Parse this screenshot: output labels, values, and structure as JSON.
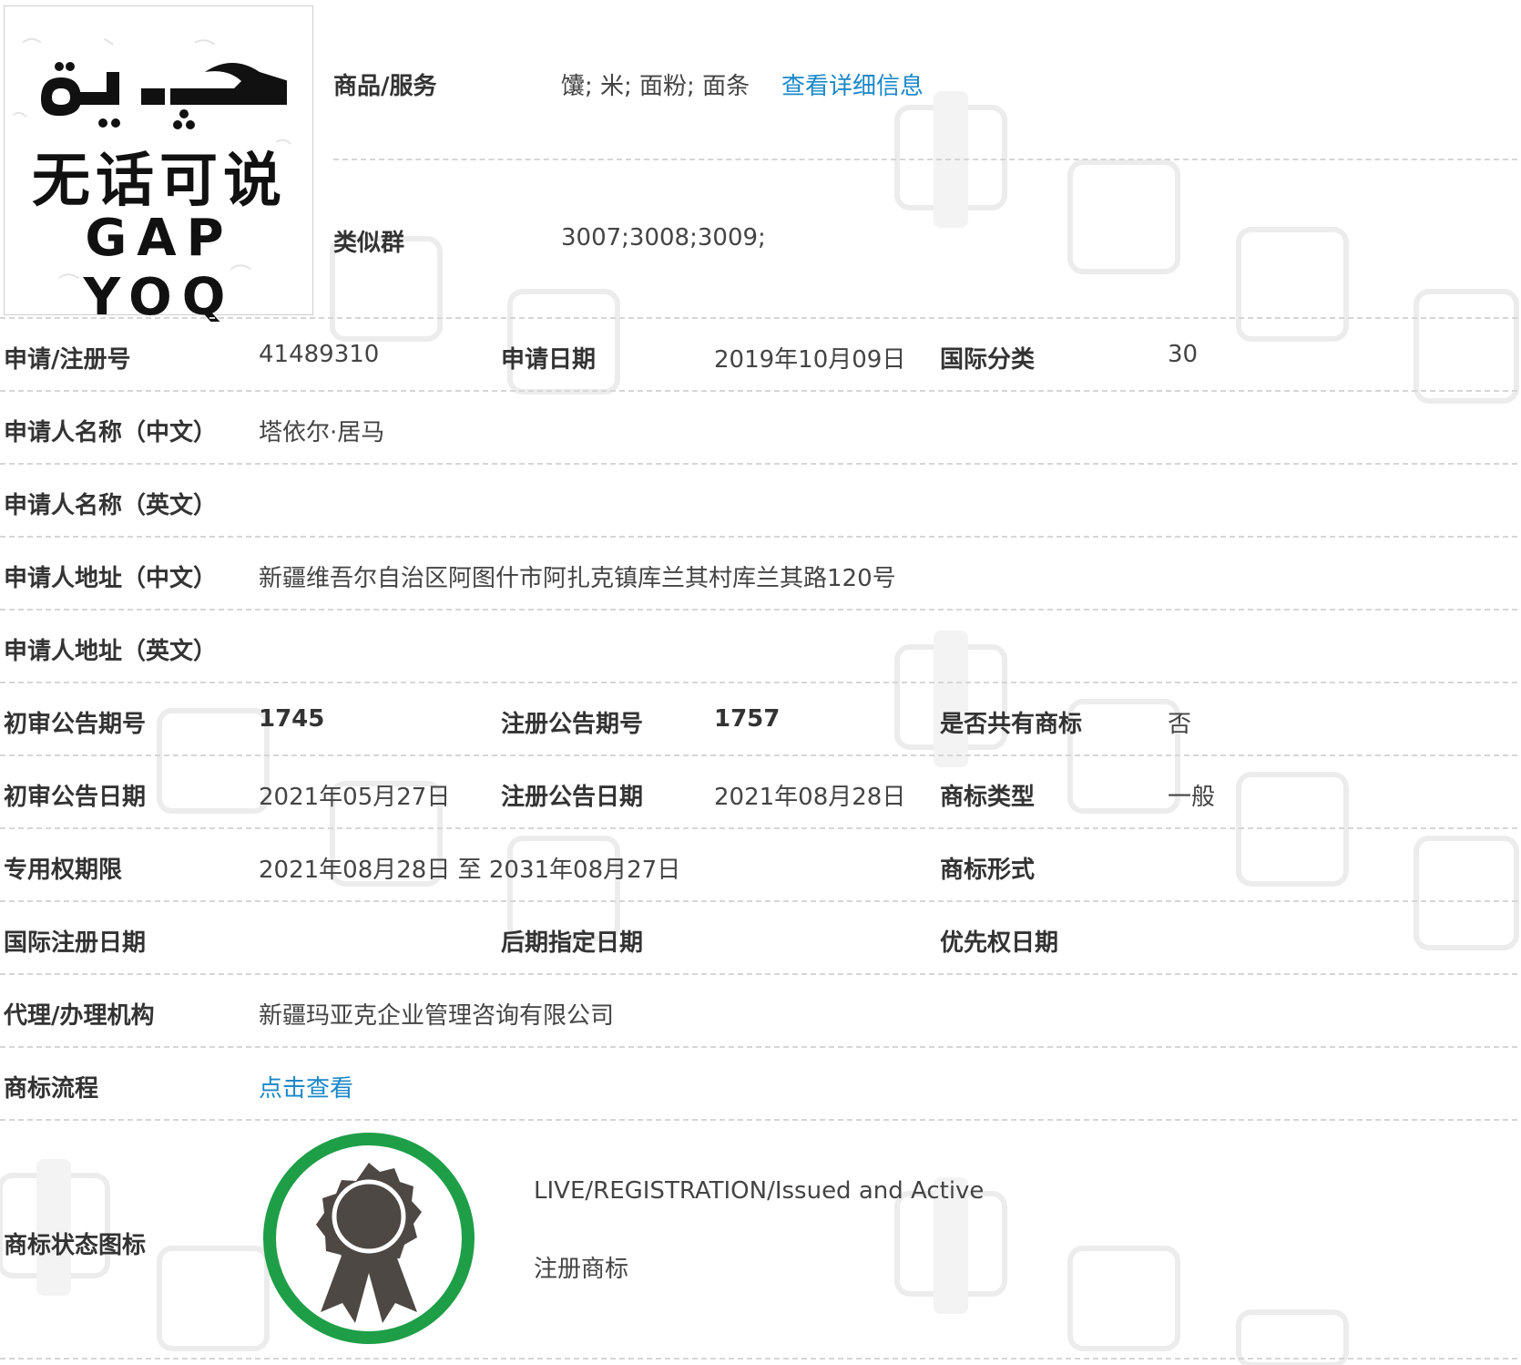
{
  "trademark": {
    "uyghur_text": "گەپ يوق",
    "chinese_text": "无话可说",
    "latin_text": "GAP YOQ"
  },
  "goods": {
    "label": "商品/服务",
    "value": "馕; 米; 面粉; 面条",
    "detail_link": "查看详细信息"
  },
  "similar_group": {
    "label": "类似群",
    "value": "3007;3008;3009;"
  },
  "fields": {
    "reg_no_label": "申请/注册号",
    "reg_no": "41489310",
    "apply_date_label": "申请日期",
    "apply_date": "2019年10月09日",
    "intl_class_label": "国际分类",
    "intl_class": "30",
    "applicant_cn_label": "申请人名称（中文）",
    "applicant_cn": "塔依尔·居马",
    "applicant_en_label": "申请人名称（英文）",
    "applicant_en": "",
    "address_cn_label": "申请人地址（中文）",
    "address_cn": "新疆维吾尔自治区阿图什市阿扎克镇库兰其村库兰其路120号",
    "address_en_label": "申请人地址（英文）",
    "address_en": "",
    "prelim_issue_label": "初审公告期号",
    "prelim_issue": "1745",
    "reg_issue_label": "注册公告期号",
    "reg_issue": "1757",
    "shared_label": "是否共有商标",
    "shared": "否",
    "prelim_date_label": "初审公告日期",
    "prelim_date": "2021年05月27日",
    "reg_date_label": "注册公告日期",
    "reg_date": "2021年08月28日",
    "tm_type_label": "商标类型",
    "tm_type": "一般",
    "term_label": "专用权期限",
    "term": "2021年08月28日 至 2031年08月27日",
    "tm_form_label": "商标形式",
    "tm_form": "",
    "intl_reg_date_label": "国际注册日期",
    "intl_reg_date": "",
    "later_date_label": "后期指定日期",
    "later_date": "",
    "priority_date_label": "优先权日期",
    "priority_date": "",
    "agent_label": "代理/办理机构",
    "agent": "新疆玛亚克企业管理咨询有限公司",
    "flow_label": "商标流程",
    "flow_link": "点击查看",
    "status_icon_label": "商标状态图标"
  },
  "status": {
    "english": "LIVE/REGISTRATION/Issued and Active",
    "chinese": "注册商标",
    "icon": "award-ribbon-icon",
    "ring_color": "#1e9e47",
    "medal_color": "#4e4845"
  },
  "colors": {
    "link": "#1a88c9",
    "divider": "#d6d6d6"
  }
}
